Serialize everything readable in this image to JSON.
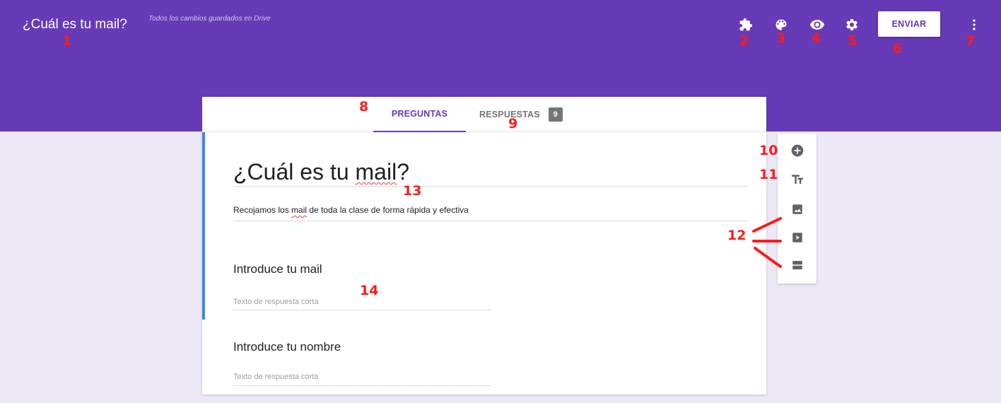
{
  "header": {
    "title": "¿Cuál es tu mail?",
    "save_status": "Todos los cambios guardados en Drive",
    "send_label": "ENVIAR",
    "icons": [
      "puzzle-icon",
      "palette-icon",
      "eye-icon",
      "gear-icon",
      "more-vert-icon"
    ]
  },
  "tabs": {
    "questions_label": "PREGUNTAS",
    "responses_label": "RESPUESTAS",
    "responses_count": "9"
  },
  "form": {
    "title_prefix": "¿Cuál es tu ",
    "title_word": "mail",
    "title_suffix": "?",
    "desc_prefix": "Recojamos los ",
    "desc_word": "mail",
    "desc_suffix": " de toda la clase de forma rápida y efectiva"
  },
  "questions": [
    {
      "title": "Introduce tu mail",
      "placeholder": "Texto de respuesta corta"
    },
    {
      "title": "Introduce tu nombre",
      "placeholder": "Texto de respuesta corta"
    }
  ],
  "toolbar": {
    "icons": [
      "add-circle-icon",
      "title-text-icon",
      "image-icon",
      "video-icon",
      "section-icon"
    ]
  },
  "callouts": [
    "1",
    "2",
    "3",
    "4",
    "5",
    "6",
    "7",
    "8",
    "9",
    "10",
    "11",
    "12",
    "13",
    "14"
  ],
  "colors": {
    "header": "#673ab7",
    "background": "#ece8f6",
    "accent": "#4285f4",
    "callout": "#ff1a1a"
  }
}
